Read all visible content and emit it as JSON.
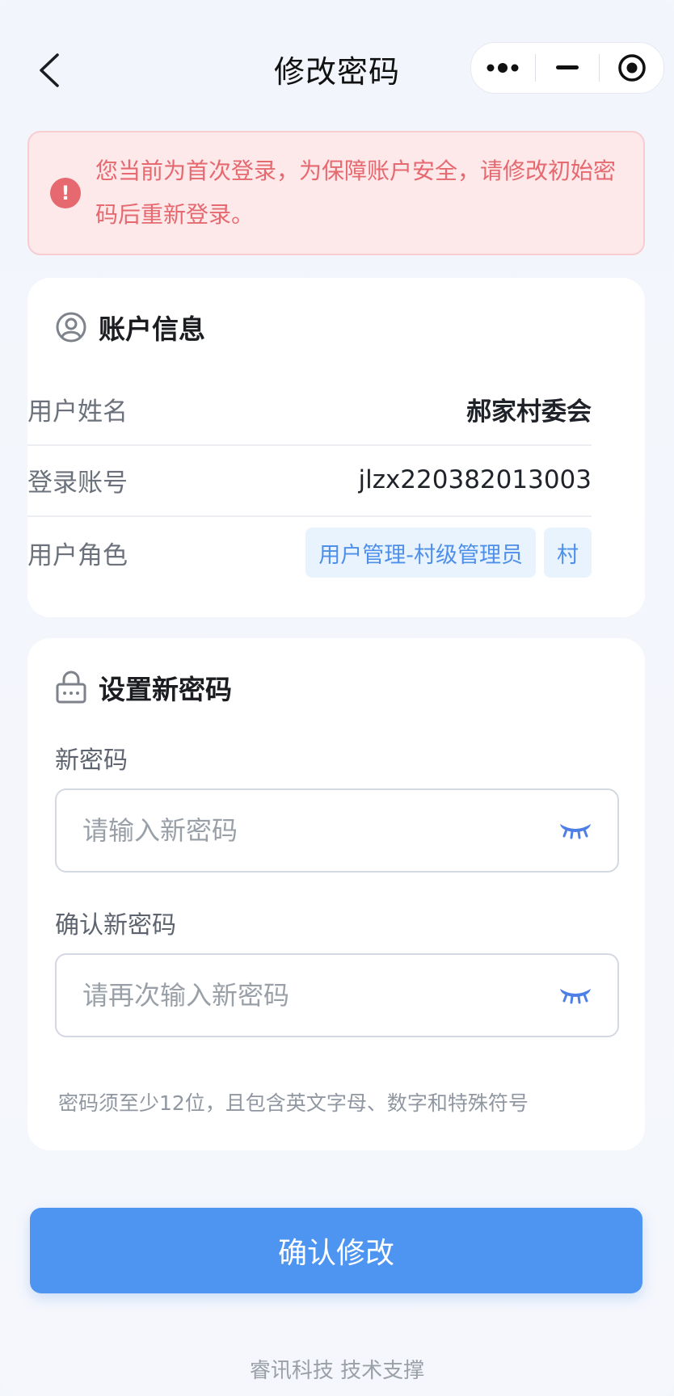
{
  "header": {
    "title": "修改密码"
  },
  "alert": {
    "message": "您当前为首次登录，为保障账户安全，请修改初始密码后重新登录。"
  },
  "account": {
    "section_title": "账户信息",
    "rows": [
      {
        "label": "用户姓名",
        "value": "郝家村委会"
      },
      {
        "label": "登录账号",
        "value": "jlzx220382013003"
      },
      {
        "label": "用户角色",
        "tags": [
          "用户管理-村级管理员",
          "村"
        ]
      }
    ]
  },
  "password": {
    "section_title": "设置新密码",
    "new_label": "新密码",
    "new_placeholder": "请输入新密码",
    "confirm_label": "确认新密码",
    "confirm_placeholder": "请再次输入新密码",
    "hint": "密码须至少12位，且包含英文字母、数字和特殊符号"
  },
  "submit": {
    "label": "确认修改"
  },
  "footer": {
    "text": "睿讯科技 技术支撑"
  },
  "colors": {
    "accent": "#4e95f2",
    "alert_text": "#e5696f",
    "alert_bg": "#fde8ea",
    "tag_bg": "#e9f3fd",
    "tag_text": "#4e8fea"
  },
  "icons": {
    "back": "chevron-left-icon",
    "more": "more-dots-icon",
    "minimize": "minimize-icon",
    "close": "target-close-icon",
    "alert": "exclamation-icon",
    "account": "user-circle-icon",
    "password": "lock-icon",
    "eye": "eye-closed-icon"
  }
}
